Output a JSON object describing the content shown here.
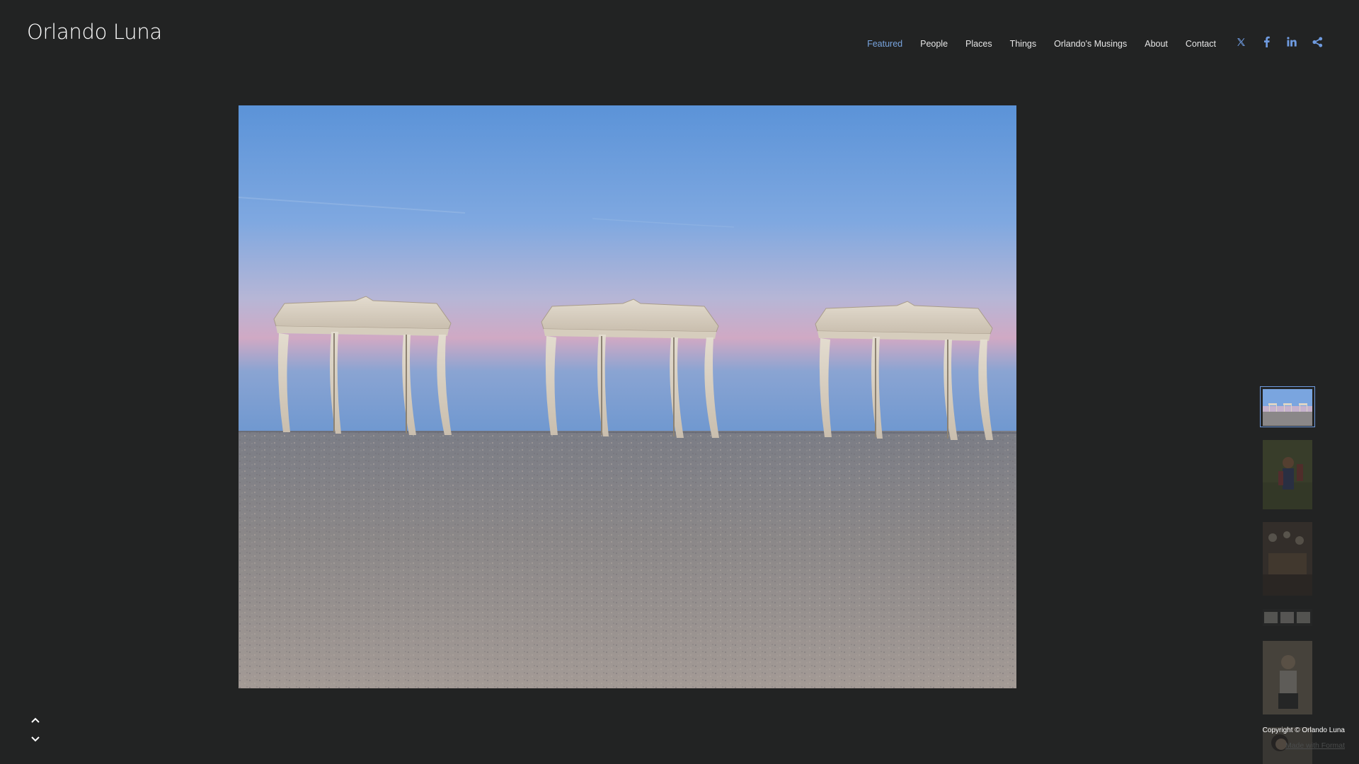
{
  "site": {
    "title": "Orlando Luna"
  },
  "nav": {
    "items": [
      {
        "label": "Featured",
        "active": true
      },
      {
        "label": "People",
        "active": false
      },
      {
        "label": "Places",
        "active": false
      },
      {
        "label": "Things",
        "active": false
      },
      {
        "label": "Orlando's Musings",
        "active": false
      },
      {
        "label": "About",
        "active": false
      },
      {
        "label": "Contact",
        "active": false
      }
    ]
  },
  "social": {
    "icons": [
      "x-icon",
      "facebook-icon",
      "linkedin-icon",
      "share-icon"
    ],
    "color": "#6f9be0"
  },
  "gallery": {
    "current_index": 0,
    "thumbnails": [
      "beach-cabanas",
      "person-orange",
      "crowd-dark",
      "three-cabanas-small",
      "person-seated",
      "portrait-dark"
    ]
  },
  "controls": {
    "prev_icon": "chevron-up-icon",
    "next_icon": "chevron-down-icon"
  },
  "footer": {
    "copyright": "Copyright © Orlando Luna",
    "made_with": "Made with Format"
  },
  "colors": {
    "background": "#222323",
    "accent": "#78a4de",
    "text": "#e6e6e6"
  }
}
